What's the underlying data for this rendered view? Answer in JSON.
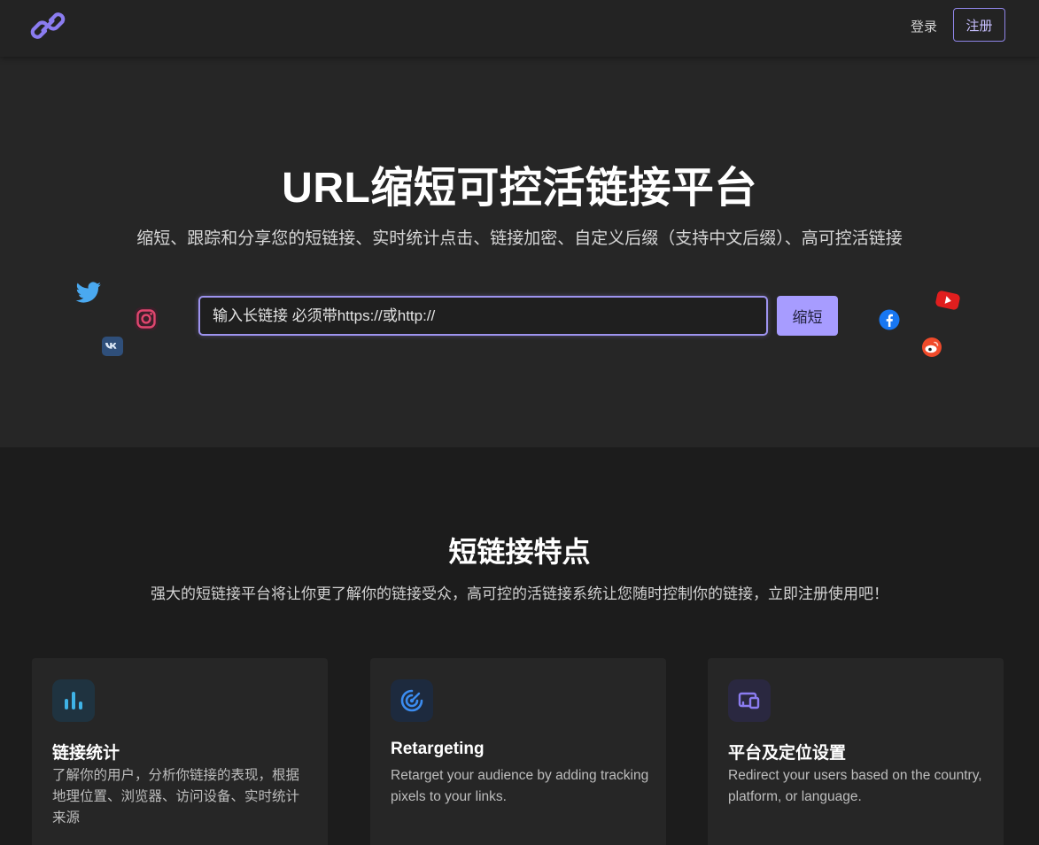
{
  "header": {
    "logo_icon": "chain-link-icon",
    "login_label": "登录",
    "register_label": "注册"
  },
  "hero": {
    "title": "URL缩短可控活链接平台",
    "subtitle": "缩短、跟踪和分享您的短链接、实时统计点击、链接加密、自定义后缀（支持中文后缀）、高可控活链接",
    "input_value": "",
    "input_placeholder": "输入长链接 必须带https://或http://",
    "shorten_label": "缩短",
    "social_icons": [
      "twitter-icon",
      "instagram-icon",
      "vk-icon",
      "facebook-icon",
      "youtube-icon",
      "weibo-icon"
    ]
  },
  "features": {
    "title": "短链接特点",
    "subtitle": "强大的短链接平台将让你更了解你的链接受众，高可控的活链接系统让您随时控制你的链接，立即注册使用吧！",
    "cards": [
      {
        "icon": "bar-chart-icon",
        "title": "链接统计",
        "desc": "了解你的用户，分析你链接的表现，根据地理位置、浏览器、访问设备、实时统计来源"
      },
      {
        "icon": "target-icon",
        "title": "Retargeting",
        "desc": "Retarget your audience by adding tracking pixels to your links."
      },
      {
        "icon": "devices-icon",
        "title": "平台及定位设置",
        "desc": "Redirect your users based on the country, platform, or language."
      }
    ]
  },
  "colors": {
    "accent": "#a79cff",
    "background": "#1c1c1c",
    "hero_background": "#262626"
  }
}
